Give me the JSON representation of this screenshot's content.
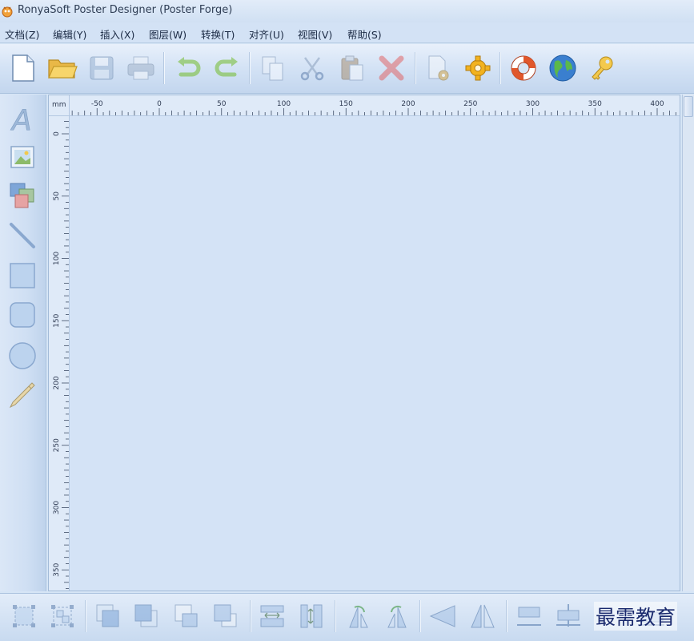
{
  "window": {
    "title": "RonyaSoft Poster Designer (Poster Forge)"
  },
  "menu": [
    "文档(Z)",
    "编辑(Y)",
    "插入(X)",
    "图层(W)",
    "转换(T)",
    "对齐(U)",
    "视图(V)",
    "帮助(S)"
  ],
  "toolbar": {
    "buttons": [
      "new-document",
      "open-folder",
      "save",
      "print",
      "undo",
      "redo",
      "copy",
      "cut",
      "paste",
      "delete",
      "page-settings",
      "preferences",
      "help",
      "website",
      "register"
    ]
  },
  "tools": [
    "text",
    "image",
    "clipart",
    "line",
    "rectangle",
    "rounded-rectangle",
    "ellipse",
    "pencil"
  ],
  "rulers": {
    "unit": "mm",
    "horizontal_labels": [
      "-50",
      "0",
      "50",
      "100",
      "150",
      "200",
      "250",
      "300",
      "350",
      "400"
    ],
    "vertical_labels": [
      "0",
      "50",
      "100",
      "150",
      "200",
      "250",
      "300",
      "350"
    ]
  },
  "bottom_toolbar": {
    "buttons": [
      "select-object",
      "select-group",
      "bring-to-front",
      "send-to-back",
      "bring-forward",
      "send-backward",
      "same-width",
      "same-height",
      "rotate-left",
      "rotate-right",
      "flip-horizontal",
      "flip-vertical",
      "align-top",
      "align-middle"
    ]
  },
  "watermark": "最需教育",
  "colors": {
    "canvas": "#d4e3f6",
    "accent": "#4a8fd6",
    "menu_text": "#1b2a44"
  }
}
